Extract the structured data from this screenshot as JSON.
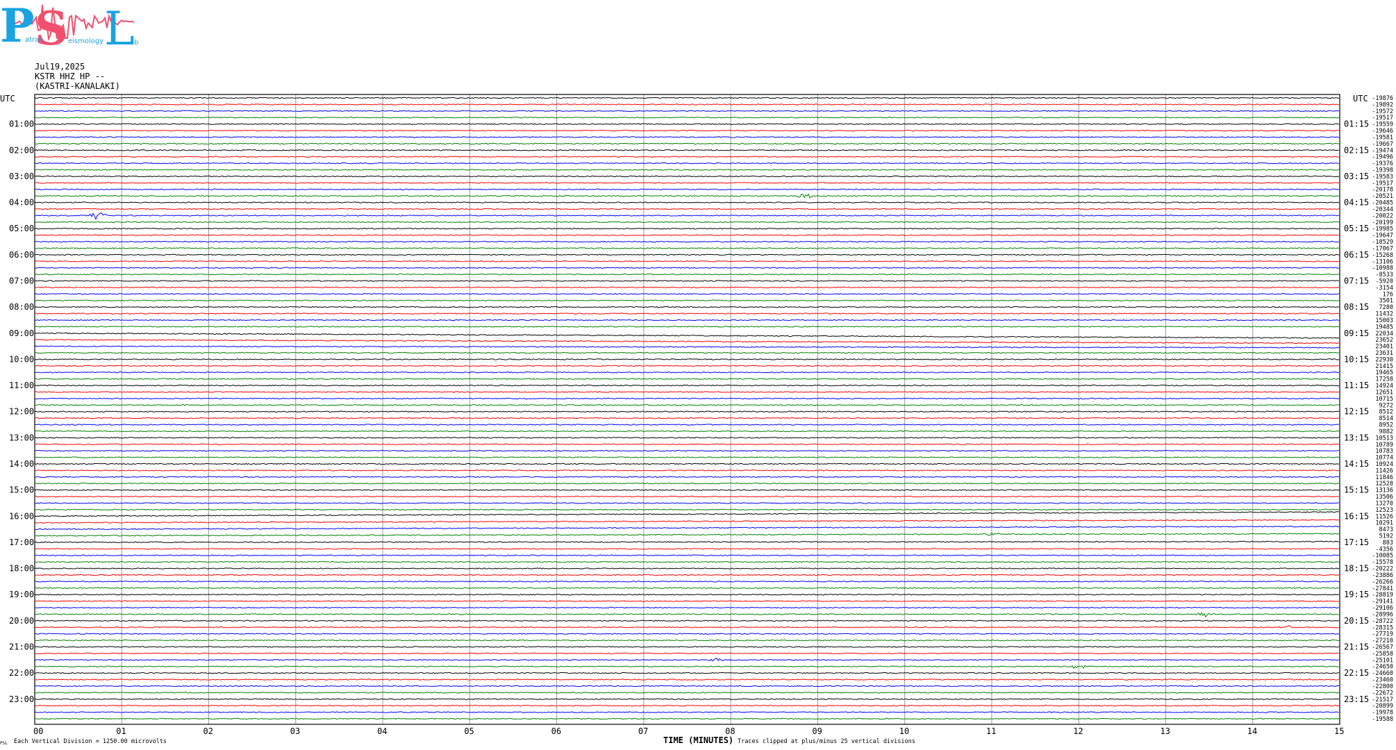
{
  "header": {
    "date": "Jul19,2025",
    "station_line": "KSTR HHZ HP --",
    "location": "(KASTRI-KANALAKI)"
  },
  "logo": {
    "letters": [
      "P",
      "S",
      "L"
    ],
    "words": [
      "atras",
      "eismology",
      "ab"
    ],
    "colors": {
      "blue": "#1aa3e0",
      "red": "#f0506e"
    }
  },
  "chart_data": {
    "type": "line",
    "title": "",
    "left_axis_title": "UTC",
    "right_axis_title": "UTC",
    "xlabel": "TIME (MINUTES)",
    "x_ticks": [
      "00",
      "01",
      "02",
      "03",
      "04",
      "05",
      "06",
      "07",
      "08",
      "09",
      "10",
      "11",
      "12",
      "13",
      "14",
      "15"
    ],
    "xlim": [
      0,
      15
    ],
    "left_hour_labels": [
      "01:00",
      "02:00",
      "03:00",
      "04:00",
      "05:00",
      "06:00",
      "07:00",
      "08:00",
      "09:00",
      "10:00",
      "11:00",
      "12:00",
      "13:00",
      "14:00",
      "15:00",
      "16:00",
      "17:00",
      "18:00",
      "19:00",
      "20:00",
      "21:00",
      "22:00",
      "23:00"
    ],
    "right_hour_labels": [
      "01:15",
      "02:15",
      "03:15",
      "04:15",
      "05:15",
      "06:15",
      "07:15",
      "08:15",
      "09:15",
      "10:15",
      "11:15",
      "12:15",
      "13:15",
      "14:15",
      "15:15",
      "16:15",
      "17:15",
      "18:15",
      "19:15",
      "20:15",
      "21:15",
      "22:15",
      "23:15"
    ],
    "trace_colors": [
      "#000000",
      "#ff0000",
      "#0000ff",
      "#008000"
    ],
    "trace_count": 96,
    "minutes_per_trace": 15,
    "right_offsets": [
      -19876,
      -19892,
      -19572,
      -19517,
      -19559,
      -19646,
      -19581,
      -19667,
      -19474,
      -19496,
      -19376,
      -19398,
      -19583,
      -19517,
      -20178,
      -20521,
      -20485,
      -20344,
      -20022,
      -20199,
      -19985,
      -19647,
      -18529,
      -17067,
      -15268,
      -13106,
      -10988,
      -8533,
      -5920,
      -3154,
      176,
      3501,
      7280,
      11432,
      15003,
      19485,
      22034,
      23652,
      23401,
      23631,
      22930,
      21415,
      19465,
      17258,
      14924,
      12651,
      10715,
      9272,
      8512,
      8514,
      8952,
      9882,
      10513,
      10789,
      10783,
      10774,
      10924,
      11426,
      11846,
      12528,
      13136,
      13506,
      13270,
      12523,
      11526,
      10291,
      8473,
      5192,
      883,
      -4356,
      -10085,
      -15578,
      -20222,
      -23886,
      -26266,
      -27841,
      -28819,
      -29141,
      -29106,
      -28996,
      -28722,
      -28315,
      -27719,
      -27210,
      -26567,
      -25858,
      -25101,
      -24650,
      -24660,
      -23460,
      -22800,
      -22672,
      -21517,
      -20899,
      -19978,
      -19588
    ],
    "annotations": [
      "Traces clipped at plus/minus 25 vertical divisions"
    ],
    "scale_note": "Each Vertical Division = 1250.00 microvolts",
    "footer_mark": "PSL",
    "drifts": [
      {
        "trace": 36,
        "type": "down",
        "amount": 7
      },
      {
        "trace": 37,
        "type": "down",
        "amount": 5
      },
      {
        "trace": 38,
        "type": "down",
        "amount": 2
      },
      {
        "trace": 64,
        "type": "up",
        "amount": 6
      },
      {
        "trace": 65,
        "type": "up",
        "amount": 4
      },
      {
        "trace": 66,
        "type": "up",
        "amount": 4
      },
      {
        "trace": 67,
        "type": "up",
        "amount": 3
      },
      {
        "trace": 68,
        "type": "up",
        "amount": 1
      }
    ],
    "events": [
      {
        "trace": 15,
        "minute": 8.85,
        "amplitude": 5
      },
      {
        "trace": 18,
        "minute": 0.72,
        "amplitude": 7
      },
      {
        "trace": 67,
        "minute": 11.0,
        "amplitude": 3
      },
      {
        "trace": 79,
        "minute": 13.45,
        "amplitude": 4
      },
      {
        "trace": 81,
        "minute": 14.4,
        "amplitude": 3
      },
      {
        "trace": 86,
        "minute": 7.85,
        "amplitude": 3
      },
      {
        "trace": 87,
        "minute": 12.0,
        "amplitude": 5
      }
    ]
  }
}
